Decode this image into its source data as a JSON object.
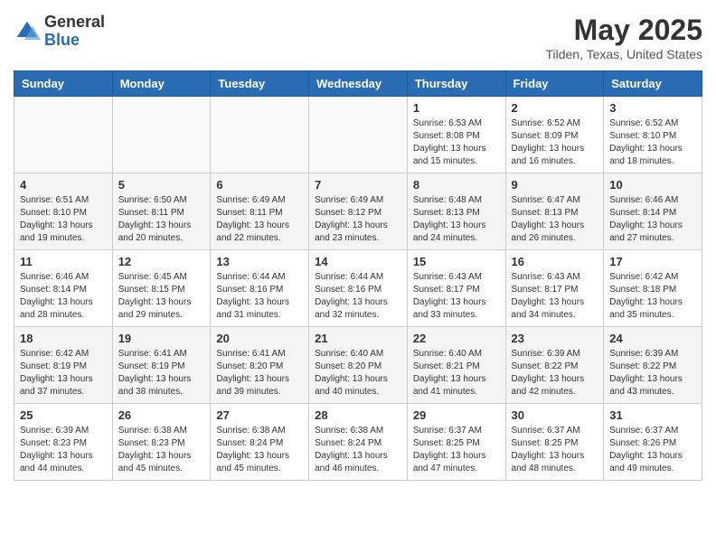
{
  "header": {
    "logo_general": "General",
    "logo_blue": "Blue",
    "month_year": "May 2025",
    "location": "Tilden, Texas, United States"
  },
  "weekdays": [
    "Sunday",
    "Monday",
    "Tuesday",
    "Wednesday",
    "Thursday",
    "Friday",
    "Saturday"
  ],
  "weeks": [
    [
      {
        "day": "",
        "info": ""
      },
      {
        "day": "",
        "info": ""
      },
      {
        "day": "",
        "info": ""
      },
      {
        "day": "",
        "info": ""
      },
      {
        "day": "1",
        "info": "Sunrise: 6:53 AM\nSunset: 8:08 PM\nDaylight: 13 hours\nand 15 minutes."
      },
      {
        "day": "2",
        "info": "Sunrise: 6:52 AM\nSunset: 8:09 PM\nDaylight: 13 hours\nand 16 minutes."
      },
      {
        "day": "3",
        "info": "Sunrise: 6:52 AM\nSunset: 8:10 PM\nDaylight: 13 hours\nand 18 minutes."
      }
    ],
    [
      {
        "day": "4",
        "info": "Sunrise: 6:51 AM\nSunset: 8:10 PM\nDaylight: 13 hours\nand 19 minutes."
      },
      {
        "day": "5",
        "info": "Sunrise: 6:50 AM\nSunset: 8:11 PM\nDaylight: 13 hours\nand 20 minutes."
      },
      {
        "day": "6",
        "info": "Sunrise: 6:49 AM\nSunset: 8:11 PM\nDaylight: 13 hours\nand 22 minutes."
      },
      {
        "day": "7",
        "info": "Sunrise: 6:49 AM\nSunset: 8:12 PM\nDaylight: 13 hours\nand 23 minutes."
      },
      {
        "day": "8",
        "info": "Sunrise: 6:48 AM\nSunset: 8:13 PM\nDaylight: 13 hours\nand 24 minutes."
      },
      {
        "day": "9",
        "info": "Sunrise: 6:47 AM\nSunset: 8:13 PM\nDaylight: 13 hours\nand 26 minutes."
      },
      {
        "day": "10",
        "info": "Sunrise: 6:46 AM\nSunset: 8:14 PM\nDaylight: 13 hours\nand 27 minutes."
      }
    ],
    [
      {
        "day": "11",
        "info": "Sunrise: 6:46 AM\nSunset: 8:14 PM\nDaylight: 13 hours\nand 28 minutes."
      },
      {
        "day": "12",
        "info": "Sunrise: 6:45 AM\nSunset: 8:15 PM\nDaylight: 13 hours\nand 29 minutes."
      },
      {
        "day": "13",
        "info": "Sunrise: 6:44 AM\nSunset: 8:16 PM\nDaylight: 13 hours\nand 31 minutes."
      },
      {
        "day": "14",
        "info": "Sunrise: 6:44 AM\nSunset: 8:16 PM\nDaylight: 13 hours\nand 32 minutes."
      },
      {
        "day": "15",
        "info": "Sunrise: 6:43 AM\nSunset: 8:17 PM\nDaylight: 13 hours\nand 33 minutes."
      },
      {
        "day": "16",
        "info": "Sunrise: 6:43 AM\nSunset: 8:17 PM\nDaylight: 13 hours\nand 34 minutes."
      },
      {
        "day": "17",
        "info": "Sunrise: 6:42 AM\nSunset: 8:18 PM\nDaylight: 13 hours\nand 35 minutes."
      }
    ],
    [
      {
        "day": "18",
        "info": "Sunrise: 6:42 AM\nSunset: 8:19 PM\nDaylight: 13 hours\nand 37 minutes."
      },
      {
        "day": "19",
        "info": "Sunrise: 6:41 AM\nSunset: 8:19 PM\nDaylight: 13 hours\nand 38 minutes."
      },
      {
        "day": "20",
        "info": "Sunrise: 6:41 AM\nSunset: 8:20 PM\nDaylight: 13 hours\nand 39 minutes."
      },
      {
        "day": "21",
        "info": "Sunrise: 6:40 AM\nSunset: 8:20 PM\nDaylight: 13 hours\nand 40 minutes."
      },
      {
        "day": "22",
        "info": "Sunrise: 6:40 AM\nSunset: 8:21 PM\nDaylight: 13 hours\nand 41 minutes."
      },
      {
        "day": "23",
        "info": "Sunrise: 6:39 AM\nSunset: 8:22 PM\nDaylight: 13 hours\nand 42 minutes."
      },
      {
        "day": "24",
        "info": "Sunrise: 6:39 AM\nSunset: 8:22 PM\nDaylight: 13 hours\nand 43 minutes."
      }
    ],
    [
      {
        "day": "25",
        "info": "Sunrise: 6:39 AM\nSunset: 8:23 PM\nDaylight: 13 hours\nand 44 minutes."
      },
      {
        "day": "26",
        "info": "Sunrise: 6:38 AM\nSunset: 8:23 PM\nDaylight: 13 hours\nand 45 minutes."
      },
      {
        "day": "27",
        "info": "Sunrise: 6:38 AM\nSunset: 8:24 PM\nDaylight: 13 hours\nand 45 minutes."
      },
      {
        "day": "28",
        "info": "Sunrise: 6:38 AM\nSunset: 8:24 PM\nDaylight: 13 hours\nand 46 minutes."
      },
      {
        "day": "29",
        "info": "Sunrise: 6:37 AM\nSunset: 8:25 PM\nDaylight: 13 hours\nand 47 minutes."
      },
      {
        "day": "30",
        "info": "Sunrise: 6:37 AM\nSunset: 8:25 PM\nDaylight: 13 hours\nand 48 minutes."
      },
      {
        "day": "31",
        "info": "Sunrise: 6:37 AM\nSunset: 8:26 PM\nDaylight: 13 hours\nand 49 minutes."
      }
    ]
  ]
}
